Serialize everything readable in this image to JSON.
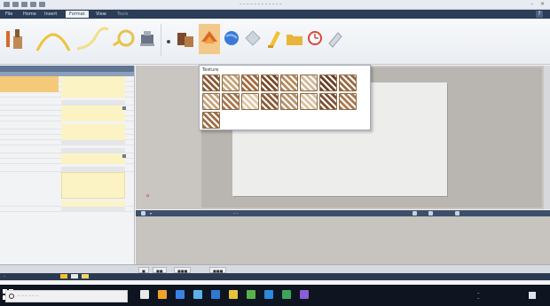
{
  "window": {
    "title": "– – – – – – – – – – – –",
    "minimize": "–",
    "close": "×"
  },
  "menu": {
    "tabs": [
      {
        "label": "File"
      },
      {
        "label": "Home"
      },
      {
        "label": "Insert"
      },
      {
        "label": "Format"
      },
      {
        "label": "View"
      },
      {
        "label": "Tools"
      }
    ],
    "help": "?"
  },
  "ribbon": {
    "tools": [
      "brush-tool",
      "arc-tool",
      "curve-tool",
      "ellipse-tool",
      "stamp-tool",
      "dots-tool",
      "fill-tool",
      "texture-tool",
      "globe-tool",
      "diamond-tool",
      "highlighter-tool",
      "folder-tool",
      "clock-tool",
      "eraser-tool"
    ],
    "colors": {
      "accent": "#e08a2a",
      "blue": "#3b7bd6",
      "yellow": "#f2c12e",
      "red": "#d9463b"
    }
  },
  "palette": {
    "title": "Texture",
    "swatches": [
      "#8b5a33",
      "#c9a37a",
      "#a76b3b",
      "#7a4a2a",
      "#b88a5c",
      "#d2b79a",
      "#6e4126",
      "#9c6a44",
      "#c8a47c",
      "#a8794f",
      "#e0c9a8",
      "#8c5b35",
      "#b9946e",
      "#d8c2a0",
      "#7d5236",
      "#ab7a4e",
      "#9e6f47"
    ]
  },
  "canvas": {
    "corner_label": "a"
  },
  "lower_panel": {
    "label_left": "▾",
    "label_mid": "– –"
  },
  "bottom": {
    "tabs": [
      "■",
      "■■",
      "■■■",
      "■■■"
    ]
  },
  "statusbar": {
    "left": "–"
  },
  "taskbar": {
    "search_placeholder": "– – – – – –",
    "apps": [
      "#e8e8e8",
      "#f0a12a",
      "#3b82e6",
      "#59b3e8",
      "#2f7ad1",
      "#e8c23a",
      "#58b24a",
      "#2c8ad8",
      "#3ba55c",
      "#8a5cd6"
    ],
    "tray": {
      "time": "–",
      "date": "–"
    }
  }
}
